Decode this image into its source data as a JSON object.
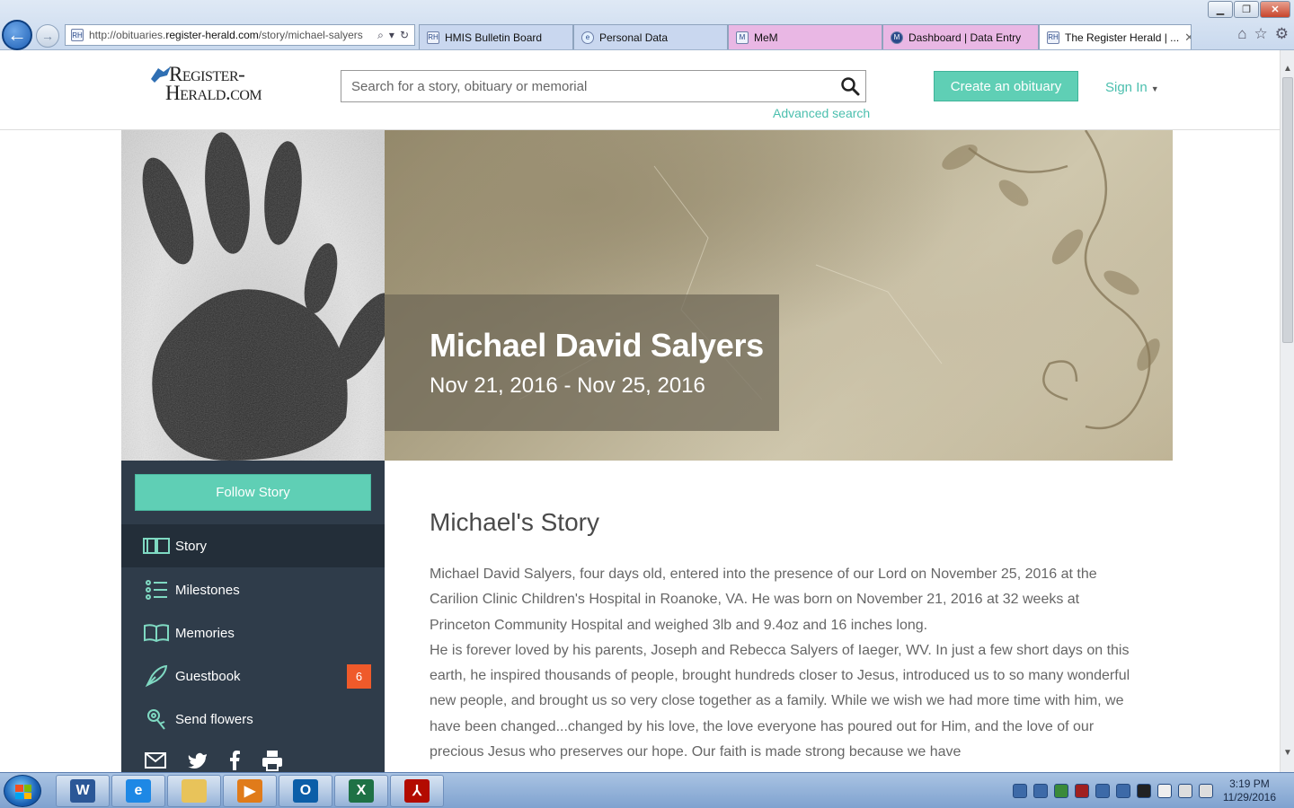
{
  "browser": {
    "url_prefix": "http://obituaries.",
    "url_domain": "register-herald.com",
    "url_rest": "/story/michael-salyers",
    "tabs": [
      {
        "label": "HMIS Bulletin Board",
        "color": "#c9d7ef"
      },
      {
        "label": "Personal Data",
        "color": "#c9d7ef"
      },
      {
        "label": "MeM",
        "color": "#e9b7e4"
      },
      {
        "label": "Dashboard | Data Entry",
        "color": "#e9b7e4"
      },
      {
        "label": "The Register Herald | ...",
        "color": "#ffffff"
      }
    ],
    "close_tab_glyph": "✕"
  },
  "header": {
    "logo_top": "Register-",
    "logo_bottom": "Herald.com",
    "search_placeholder": "Search for a story, obituary or memorial",
    "advanced_search": "Advanced search",
    "create_button": "Create an obituary",
    "sign_in": "Sign In"
  },
  "hero": {
    "name": "Michael David Salyers",
    "dates": "Nov 21, 2016 - Nov 25, 2016"
  },
  "sidebar": {
    "follow_button": "Follow Story",
    "items": [
      {
        "label": "Story",
        "icon": "book-icon"
      },
      {
        "label": "Milestones",
        "icon": "list-icon"
      },
      {
        "label": "Memories",
        "icon": "open-book-icon"
      },
      {
        "label": "Guestbook",
        "icon": "pen-icon",
        "badge": "6"
      },
      {
        "label": "Send flowers",
        "icon": "flower-icon"
      }
    ]
  },
  "story": {
    "title": "Michael's Story",
    "p1": "Michael David Salyers, four days old, entered into the presence of our Lord on November 25, 2016 at the Carilion Clinic Children's Hospital in Roanoke, VA. He was born on November 21, 2016 at 32 weeks at Princeton Community Hospital and weighed 3lb and 9.4oz and 16 inches long.",
    "p2": "He is forever loved by his parents, Joseph and Rebecca Salyers of Iaeger, WV. In just a few short days on this earth, he inspired thousands of people, brought hundreds closer to Jesus, introduced us to so many wonderful new people, and brought us so very close together as a family. While we wish we had more time with him, we have been changed...changed by his love, the love everyone has poured out for Him, and the love of our precious Jesus who preserves our hope. Our faith is made strong because we have"
  },
  "taskbar": {
    "apps": [
      {
        "name": "word",
        "letter": "W",
        "color": "#2b5797"
      },
      {
        "name": "internet-explorer",
        "letter": "e",
        "color": "#1e88e5"
      },
      {
        "name": "explorer",
        "letter": "",
        "color": "#e8c35a"
      },
      {
        "name": "media",
        "letter": "▶",
        "color": "#e07b1a"
      },
      {
        "name": "outlook",
        "letter": "O",
        "color": "#0b5ea8"
      },
      {
        "name": "excel",
        "letter": "X",
        "color": "#1e7145"
      },
      {
        "name": "acrobat",
        "letter": "⅄",
        "color": "#b30b00"
      }
    ],
    "time": "3:19 PM",
    "date": "11/29/2016"
  }
}
